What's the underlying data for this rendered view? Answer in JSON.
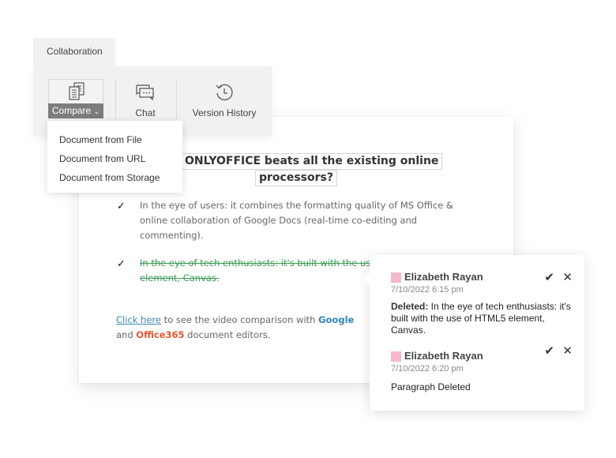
{
  "toolbar": {
    "tab_label": "Collaboration",
    "buttons": {
      "compare": {
        "label": "Compare",
        "icon": "compare-documents-icon"
      },
      "chat": {
        "label": "Chat",
        "icon": "chat-icon"
      },
      "version_history": {
        "label": "Version History",
        "icon": "history-icon"
      }
    }
  },
  "compare_menu": {
    "items": [
      {
        "label": "Document from File"
      },
      {
        "label": "Document from URL"
      },
      {
        "label": "Document from Storage"
      }
    ]
  },
  "document": {
    "title_line1": "Why ONLYOFFICE beats all the existing online",
    "title_line2": "processors?",
    "bullets": [
      {
        "icon": "checkmark-icon",
        "lines": [
          "In the eye of users: it combines the formatting quality of MS Office &",
          "online collaboration of Google Docs (real-time co-editing and",
          "commenting)."
        ],
        "deleted": false
      },
      {
        "icon": "checkmark-icon",
        "lines": [
          "In the eye of tech enthusiasts: it's built with the use of HTML5",
          "element, Canvas."
        ],
        "deleted": true
      }
    ],
    "footer": {
      "link": "Click here",
      "text1": " to see the video comparison with ",
      "google": "Google",
      "text2": "and ",
      "office": "Office365",
      "text3": " document editors."
    }
  },
  "comments": [
    {
      "author": "Elizabeth Rayan",
      "author_color": "#f5b8cc",
      "date": "7/10/2022  6:15 pm",
      "label": "Deleted:",
      "body": " In the eye of tech enthusiasts: it's built with the use of HTML5 element, Canvas."
    },
    {
      "author": "Elizabeth Rayan",
      "author_color": "#f5b8cc",
      "date": "7/10/2022  6:20 pm",
      "label": "",
      "body": "Paragraph Deleted"
    }
  ],
  "actions": {
    "accept": "✔",
    "reject": "✕"
  }
}
